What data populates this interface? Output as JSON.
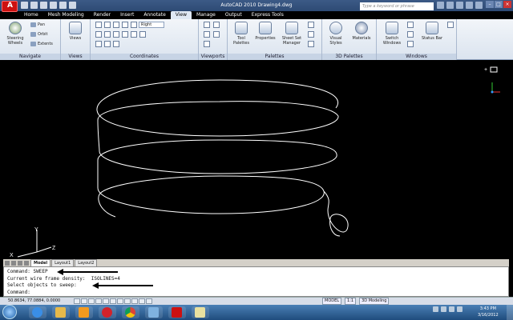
{
  "window": {
    "title": "AutoCAD 2010    Drawing4.dwg",
    "search_placeholder": "Type a keyword or phrase"
  },
  "menu": {
    "tabs": [
      "Home",
      "Mesh Modeling",
      "Render",
      "Insert",
      "Annotate",
      "View",
      "Manage",
      "Output",
      "Express Tools"
    ],
    "active": "View"
  },
  "ribbon": {
    "navigate": {
      "title": "Navigate",
      "steering": "Steering Wheels",
      "pan": "Pan",
      "orbit": "Orbit",
      "extents": "Extents"
    },
    "views": {
      "title": "Views",
      "label": "Views"
    },
    "coordinates": {
      "title": "Coordinates",
      "dropdown": "Right"
    },
    "viewports": {
      "title": "Viewports"
    },
    "palettes": {
      "title": "Palettes",
      "tool_palettes": "Tool Palettes",
      "properties": "Properties",
      "sheet_set": "Sheet Set Manager"
    },
    "palettes3d": {
      "title": "3D Palettes",
      "visual_styles": "Visual Styles",
      "materials": "Materials"
    },
    "windows": {
      "title": "Windows",
      "switch": "Switch Windows",
      "status_bar": "Status Bar"
    }
  },
  "viewport": {
    "ucs_x": "X",
    "ucs_y": "Y",
    "ucs_z": "Z",
    "nav_label": "+"
  },
  "layout_tabs": [
    "Model",
    "Layout1",
    "Layout2"
  ],
  "command": {
    "lines": [
      "Command: SWEEP",
      "Current wire frame density:  ISOLINES=4",
      "Select objects to sweep:",
      "Command:"
    ]
  },
  "status": {
    "coords": "50.8634, 77.0884, 0.0000",
    "model": "MODEL",
    "scale": "1:1",
    "workspace": "3D Modeling"
  },
  "taskbar": {
    "time": "3:43 PM",
    "date": "3/16/2012"
  },
  "colors": {
    "viewport_bg": "#000000",
    "helix": "#ffffff",
    "title_bar": "#2d4a74",
    "taskbar": "#1f4c7d"
  }
}
